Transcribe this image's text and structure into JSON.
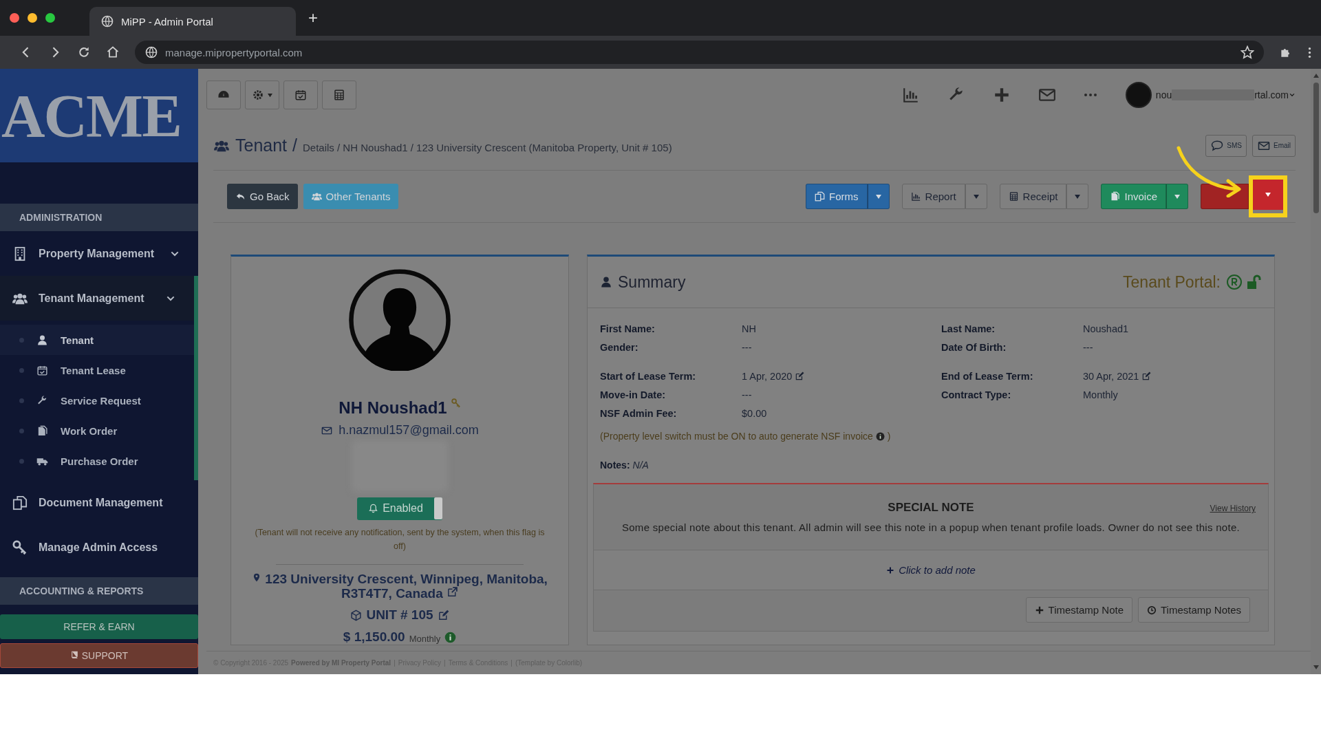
{
  "browser": {
    "tab_title": "MiPP - Admin Portal",
    "new_tab": "+",
    "url": "manage.mipropertyportal.com"
  },
  "sidebar": {
    "logo": "ACME",
    "sections": [
      {
        "title": "ADMINISTRATION",
        "items": [
          {
            "label": "Property Management",
            "expanded": false,
            "has_children": true
          },
          {
            "label": "Tenant Management",
            "expanded": true,
            "has_children": true,
            "children": [
              {
                "label": "Tenant",
                "selected": true
              },
              {
                "label": "Tenant Lease",
                "selected": false
              },
              {
                "label": "Service Request",
                "selected": false
              },
              {
                "label": "Work Order",
                "selected": false
              },
              {
                "label": "Purchase Order",
                "selected": false
              }
            ]
          },
          {
            "label": "Document Management",
            "expanded": false,
            "has_children": false
          },
          {
            "label": "Manage Admin Access",
            "expanded": false,
            "has_children": false
          }
        ]
      },
      {
        "title": "ACCOUNTING & REPORTS"
      }
    ],
    "refer": "REFER & EARN",
    "support": "SUPPORT"
  },
  "topbar": {
    "user_start": "nou",
    "user_end": "rtal.com"
  },
  "breadcrumb": {
    "title": "Tenant",
    "separator": "/",
    "path": "Details / NH Noushad1 / 123 University Crescent (Manitoba Property, Unit # 105)"
  },
  "contact_buttons": [
    {
      "label": "SMS"
    },
    {
      "label": "Email"
    }
  ],
  "left_buttons": [
    {
      "label": "Go Back",
      "color": "#2c3640"
    },
    {
      "label": "Other Tenants",
      "color": "#3a8db0"
    }
  ],
  "split_buttons": [
    {
      "label": "Forms",
      "color": "#2866a3",
      "highlighted": false
    },
    {
      "label": "Report",
      "color": "#808080",
      "highlighted": false
    },
    {
      "label": "Receipt",
      "color": "#808080",
      "highlighted": false
    },
    {
      "label": "Invoice",
      "color": "#1f8a5c",
      "highlighted": false
    },
    {
      "color": "#a12323",
      "highlighted": true
    }
  ],
  "profile": {
    "name": "NH Noushad1",
    "email": "h.nazmul157@gmail.com",
    "notify": {
      "label": "Enabled",
      "on": true
    },
    "notice": "(Tenant will not receive any notification, sent by the system, when this flag is off)",
    "address": "123 University Crescent, Winnipeg, Manitoba, R3T4T7, Canada",
    "unit": "UNIT # 105",
    "rent": "$ 1,150.00",
    "rent_period": "Monthly"
  },
  "summary": {
    "title": "Summary",
    "portal_label": "Tenant Portal:",
    "groups": [
      [
        {
          "label": "First Name:",
          "value": "NH"
        },
        {
          "label": "Last Name:",
          "value": "Noushad1"
        },
        {
          "label": "Gender:",
          "value": "---"
        },
        {
          "label": "Date Of Birth:",
          "value": "---"
        }
      ],
      [
        {
          "label": "Start of Lease Term:",
          "value": "1 Apr, 2020",
          "editable": true
        },
        {
          "label": "End of Lease Term:",
          "value": "30 Apr, 2021",
          "editable": true
        },
        {
          "label": "Move-in Date:",
          "value": "---"
        },
        {
          "label": "Contract Type:",
          "value": "Monthly"
        },
        {
          "label": "NSF Admin Fee:",
          "value": "$0.00"
        }
      ]
    ],
    "nsf_note": "(Property level switch must be ON to auto generate NSF invoice",
    "nsf_note_end": ")",
    "notes_label": "Notes:",
    "notes_value": "N/A"
  },
  "special_note": {
    "title": "SPECIAL NOTE",
    "view_history": "View History",
    "text": "Some special note about this tenant. All admin will see this note in a popup when tenant profile loads. Owner do not see this note.",
    "add_note": "Click to add note",
    "buttons": [
      {
        "label": "Timestamp Note"
      },
      {
        "label": "Timestamp Notes"
      }
    ]
  },
  "footer": {
    "copyright": "© Copyright 2016 - 2025",
    "powered": "Powered by MI Property Portal",
    "separators": [
      "|",
      "|",
      "|"
    ],
    "links": [
      "Privacy Policy",
      "Terms & Conditions"
    ],
    "template": "(Template by Colorlib)"
  }
}
